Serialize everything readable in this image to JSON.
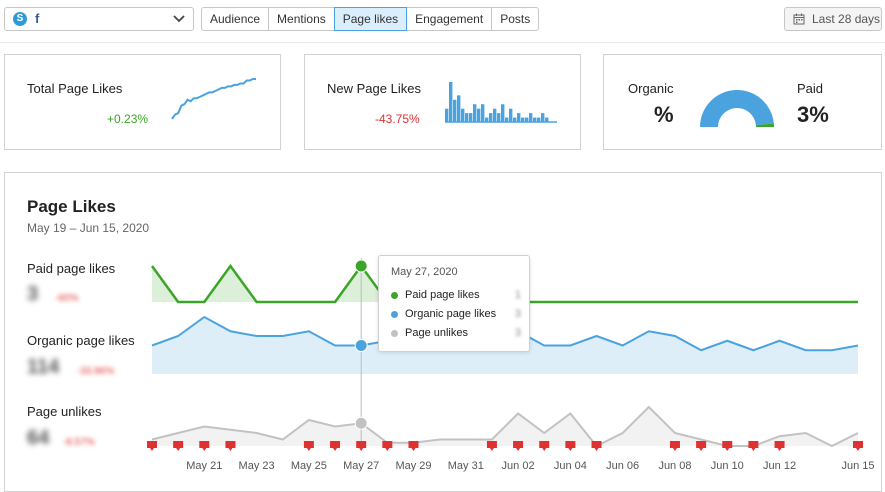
{
  "toolbar": {
    "profile": {
      "badge": "S",
      "network_glyph": "f",
      "network_icon": "facebook-icon"
    },
    "tabs": [
      {
        "label": "Audience",
        "active": false
      },
      {
        "label": "Mentions",
        "active": false
      },
      {
        "label": "Page likes",
        "active": true
      },
      {
        "label": "Engagement",
        "active": false
      },
      {
        "label": "Posts",
        "active": false
      }
    ],
    "date_range_label": "Last 28 days",
    "date_icon": "calendar-icon"
  },
  "cards": {
    "total_page_likes": {
      "title": "Total Page Likes",
      "delta": "+0.23%",
      "sparkline": [
        0,
        3,
        4,
        9,
        10,
        13,
        12,
        14,
        14,
        15,
        16,
        17,
        18,
        18,
        19,
        20,
        21,
        21,
        22,
        22,
        23,
        23,
        24,
        24,
        26,
        26,
        27,
        27
      ]
    },
    "new_page_likes": {
      "title": "New Page Likes",
      "delta": "-43.75%",
      "bars": [
        3,
        9,
        5,
        6,
        3,
        2,
        2,
        4,
        3,
        4,
        1,
        2,
        3,
        2,
        4,
        1,
        3,
        1,
        2,
        1,
        1,
        2,
        1,
        1,
        2,
        1,
        0,
        0
      ]
    },
    "organic_paid": {
      "organic_label": "Organic",
      "organic_value": "%",
      "paid_label": "Paid",
      "paid_value": "3%",
      "paid_share": 0.03
    }
  },
  "main": {
    "title": "Page Likes",
    "subtitle": "May 19 – Jun 15, 2020",
    "rows": [
      {
        "label": "Paid page likes",
        "value": "3",
        "delta": "-60%"
      },
      {
        "label": "Organic page likes",
        "value": "114",
        "delta": "-33.86%"
      },
      {
        "label": "Page unlikes",
        "value": "64",
        "delta": "-8.57%"
      }
    ],
    "tooltip": {
      "date": "May 27, 2020",
      "items": [
        {
          "name": "Paid page likes",
          "value": "1",
          "color": "#3ba527"
        },
        {
          "name": "Organic page likes",
          "value": "3",
          "color": "#4aa3df"
        },
        {
          "name": "Page unlikes",
          "value": "3",
          "color": "#c2c2c2"
        }
      ]
    }
  },
  "chart_data": {
    "type": "line",
    "x": [
      "May 19",
      "May 20",
      "May 21",
      "May 22",
      "May 23",
      "May 24",
      "May 25",
      "May 26",
      "May 27",
      "May 28",
      "May 29",
      "May 30",
      "May 31",
      "Jun 01",
      "Jun 02",
      "Jun 03",
      "Jun 04",
      "Jun 05",
      "Jun 06",
      "Jun 07",
      "Jun 08",
      "Jun 09",
      "Jun 10",
      "Jun 11",
      "Jun 12",
      "Jun 13",
      "Jun 14",
      "Jun 15"
    ],
    "tick_labels": [
      "May 21",
      "May 23",
      "May 25",
      "May 27",
      "May 29",
      "May 31",
      "Jun 02",
      "Jun 04",
      "Jun 06",
      "Jun 08",
      "Jun 10",
      "Jun 12",
      "Jun 15"
    ],
    "tick_positions": [
      2,
      4,
      6,
      8,
      10,
      12,
      14,
      16,
      18,
      20,
      22,
      24,
      27
    ],
    "series": [
      {
        "name": "Paid page likes",
        "color": "#3ba527",
        "values": [
          1,
          0,
          0,
          1,
          0,
          0,
          0,
          0,
          1,
          0,
          0,
          0,
          0,
          0,
          0,
          0,
          0,
          0,
          0,
          0,
          0,
          0,
          0,
          0,
          0,
          0,
          0,
          0
        ]
      },
      {
        "name": "Organic page likes",
        "color": "#4aa3df",
        "values": [
          3,
          4,
          6,
          4.5,
          4,
          4,
          4.5,
          3,
          3,
          3.5,
          5,
          3.5,
          3,
          4.5,
          4.5,
          3,
          3,
          4,
          3,
          4.5,
          4,
          2.5,
          3.5,
          2.5,
          3.5,
          2.5,
          2.5,
          3
        ]
      },
      {
        "name": "Page unlikes",
        "color": "#c2c2c2",
        "values": [
          1,
          2,
          3,
          2.5,
          2,
          1,
          4,
          3,
          3.5,
          0.5,
          0.5,
          1,
          1,
          1,
          5,
          2,
          5,
          0,
          2,
          6,
          2,
          1,
          0,
          0,
          1.5,
          2,
          0,
          2
        ]
      }
    ],
    "event_markers": [
      0,
      1,
      2,
      3,
      6,
      7,
      8,
      9,
      10,
      13,
      14,
      15,
      16,
      17,
      20,
      21,
      22,
      23,
      24,
      27
    ],
    "highlight_index": 8,
    "highlight_date": "May 27"
  }
}
